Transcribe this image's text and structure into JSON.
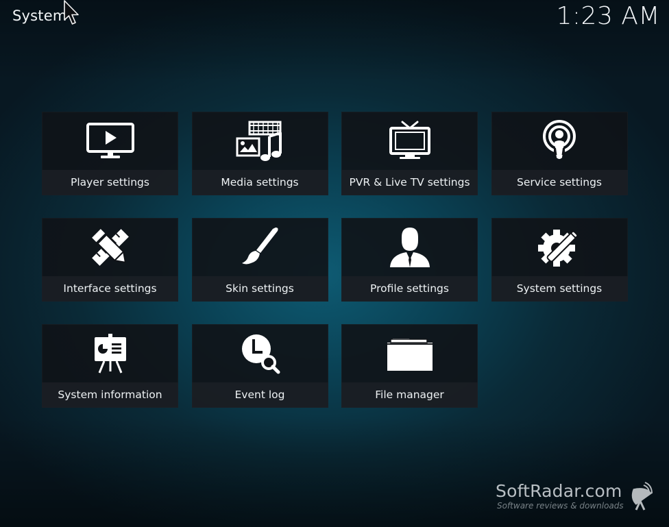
{
  "screen": {
    "title": "System",
    "time": "1:23 AM"
  },
  "tiles": [
    {
      "label": "Player settings",
      "icon": "monitor-play-icon"
    },
    {
      "label": "Media settings",
      "icon": "media-icon"
    },
    {
      "label": "PVR & Live TV settings",
      "icon": "tv-icon"
    },
    {
      "label": "Service settings",
      "icon": "podcast-icon"
    },
    {
      "label": "Interface settings",
      "icon": "pencil-ruler-icon"
    },
    {
      "label": "Skin settings",
      "icon": "paintbrush-icon"
    },
    {
      "label": "Profile settings",
      "icon": "user-profile-icon"
    },
    {
      "label": "System settings",
      "icon": "gear-wrench-icon"
    },
    {
      "label": "System information",
      "icon": "info-board-icon"
    },
    {
      "label": "Event log",
      "icon": "clock-search-icon"
    },
    {
      "label": "File manager",
      "icon": "folder-icon"
    }
  ],
  "watermark": {
    "title": "SoftRadar.com",
    "subtitle": "Software reviews & downloads",
    "icon": "satellite-dish-icon"
  },
  "colors": {
    "tile_background": "#101317",
    "tile_label_background": "#1c2026",
    "text": "#f2f5f7",
    "background_center": "#0e5b73",
    "background_edge": "#081822"
  }
}
